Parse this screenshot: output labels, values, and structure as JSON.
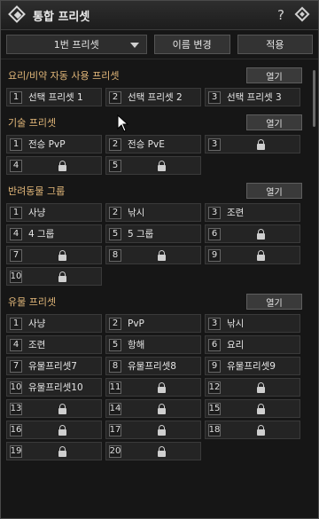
{
  "window": {
    "title": "통합 프리셋",
    "help_label": "?"
  },
  "toolbar": {
    "preset_select": "1번 프리셋",
    "rename_label": "이름 변경",
    "apply_label": "적용"
  },
  "colors": {
    "section_title": "#e3b87a",
    "background": "#161616",
    "slot": "#242424"
  },
  "sections": [
    {
      "title": "요리/비약 자동 사용 프리셋",
      "open_label": "열기",
      "slots": [
        {
          "num": "1",
          "label": "선택 프리셋 1",
          "locked": false
        },
        {
          "num": "2",
          "label": "선택 프리셋 2",
          "locked": false
        },
        {
          "num": "3",
          "label": "선택 프리셋 3",
          "locked": false
        }
      ]
    },
    {
      "title": "기술 프리셋",
      "open_label": "열기",
      "slots": [
        {
          "num": "1",
          "label": "전승 PvP",
          "locked": false
        },
        {
          "num": "2",
          "label": "전승 PvE",
          "locked": false
        },
        {
          "num": "3",
          "label": "",
          "locked": true
        },
        {
          "num": "4",
          "label": "",
          "locked": true
        },
        {
          "num": "5",
          "label": "",
          "locked": true
        }
      ]
    },
    {
      "title": "반려동물 그룹",
      "open_label": "열기",
      "slots": [
        {
          "num": "1",
          "label": "사냥",
          "locked": false
        },
        {
          "num": "2",
          "label": "낚시",
          "locked": false
        },
        {
          "num": "3",
          "label": "조련",
          "locked": false
        },
        {
          "num": "4",
          "label": "4 그룹",
          "locked": false
        },
        {
          "num": "5",
          "label": "5 그룹",
          "locked": false
        },
        {
          "num": "6",
          "label": "",
          "locked": true
        },
        {
          "num": "7",
          "label": "",
          "locked": true
        },
        {
          "num": "8",
          "label": "",
          "locked": true
        },
        {
          "num": "9",
          "label": "",
          "locked": true
        },
        {
          "num": "10",
          "label": "",
          "locked": true
        }
      ]
    },
    {
      "title": "유물 프리셋",
      "open_label": "열기",
      "slots": [
        {
          "num": "1",
          "label": "사냥",
          "locked": false
        },
        {
          "num": "2",
          "label": "PvP",
          "locked": false
        },
        {
          "num": "3",
          "label": "낚시",
          "locked": false
        },
        {
          "num": "4",
          "label": "조련",
          "locked": false
        },
        {
          "num": "5",
          "label": "항해",
          "locked": false
        },
        {
          "num": "6",
          "label": "요리",
          "locked": false
        },
        {
          "num": "7",
          "label": "유물프리셋7",
          "locked": false
        },
        {
          "num": "8",
          "label": "유물프리셋8",
          "locked": false
        },
        {
          "num": "9",
          "label": "유물프리셋9",
          "locked": false
        },
        {
          "num": "10",
          "label": "유물프리셋10",
          "locked": false
        },
        {
          "num": "11",
          "label": "",
          "locked": true
        },
        {
          "num": "12",
          "label": "",
          "locked": true
        },
        {
          "num": "13",
          "label": "",
          "locked": true
        },
        {
          "num": "14",
          "label": "",
          "locked": true
        },
        {
          "num": "15",
          "label": "",
          "locked": true
        },
        {
          "num": "16",
          "label": "",
          "locked": true
        },
        {
          "num": "17",
          "label": "",
          "locked": true
        },
        {
          "num": "18",
          "label": "",
          "locked": true
        },
        {
          "num": "19",
          "label": "",
          "locked": true
        },
        {
          "num": "20",
          "label": "",
          "locked": true
        }
      ]
    }
  ]
}
